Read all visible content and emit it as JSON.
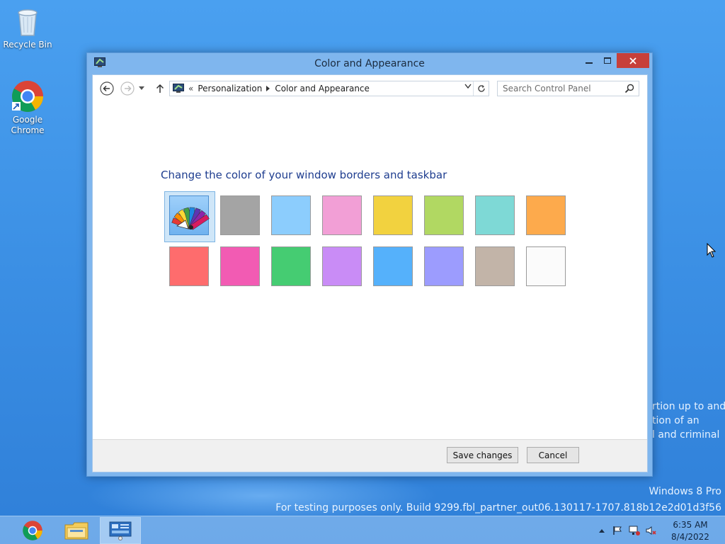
{
  "desktop": {
    "icons": [
      {
        "label": "Recycle Bin"
      },
      {
        "label_line1": "Google",
        "label_line2": "Chrome"
      }
    ],
    "background_text": {
      "line1": "rtion up to and",
      "line2": "tion of an",
      "line3": "l and criminal"
    },
    "watermark": {
      "edition": "Windows 8 Pro",
      "build": "For testing purposes only. Build 9299.fbl_partner_out06.130117-1707.818b12e2d01d3f56"
    }
  },
  "window": {
    "title": "Color and Appearance",
    "address": {
      "prefix": "«",
      "crumbs": [
        "Personalization",
        "Color and Appearance"
      ]
    },
    "search": {
      "placeholder": "Search Control Panel"
    },
    "heading": "Change the color of your window borders and taskbar",
    "swatch_colors": [
      "automatic",
      "#a4a4a4",
      "#8ccdfd",
      "#f29fd6",
      "#f2d23f",
      "#b1d862",
      "#7ed9d6",
      "#fdaa4c",
      "#fe6c6d",
      "#f25bb3",
      "#45cc72",
      "#c98cf6",
      "#55b1fb",
      "#9c9cfe",
      "#c2b4a8",
      "#fbfbfb"
    ],
    "selected_swatch": 0,
    "buttons": {
      "save": "Save changes",
      "cancel": "Cancel"
    }
  },
  "taskbar": {
    "apps": [
      "Google Chrome",
      "File Explorer",
      "Control Panel"
    ],
    "active_app": "Control Panel",
    "clock": {
      "time": "6:35 AM",
      "date": "8/4/2022"
    }
  }
}
